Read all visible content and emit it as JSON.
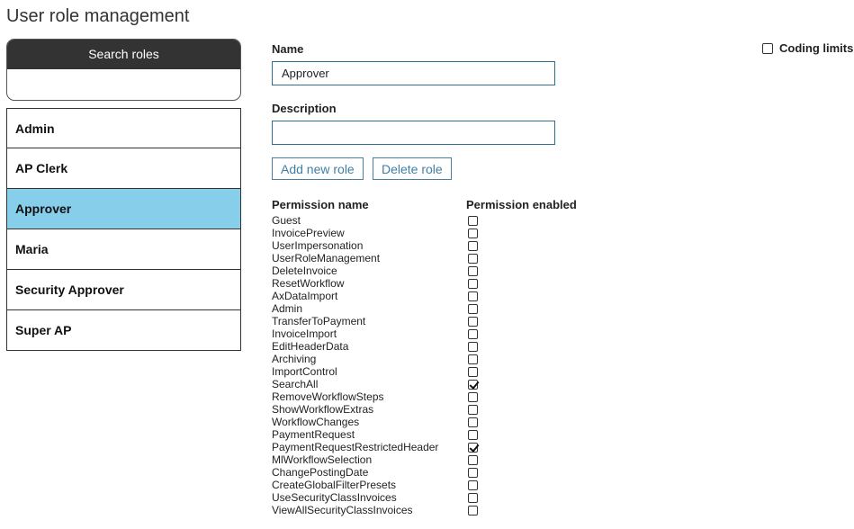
{
  "page": {
    "title": "User role management"
  },
  "search": {
    "header": "Search roles",
    "value": "",
    "placeholder": ""
  },
  "roles": [
    {
      "label": "Admin",
      "selected": false
    },
    {
      "label": "AP Clerk",
      "selected": false
    },
    {
      "label": "Approver",
      "selected": true
    },
    {
      "label": "Maria",
      "selected": false
    },
    {
      "label": "Security Approver",
      "selected": false
    },
    {
      "label": "Super AP",
      "selected": false
    }
  ],
  "form": {
    "name_label": "Name",
    "name_value": "Approver",
    "description_label": "Description",
    "description_value": "",
    "add_button": "Add new role",
    "delete_button": "Delete role",
    "coding_limits_label": "Coding limits",
    "coding_limits_checked": false
  },
  "permissions": {
    "name_header": "Permission name",
    "enabled_header": "Permission enabled",
    "items": [
      {
        "name": "Guest",
        "enabled": false
      },
      {
        "name": "InvoicePreview",
        "enabled": false
      },
      {
        "name": "UserImpersonation",
        "enabled": false
      },
      {
        "name": "UserRoleManagement",
        "enabled": false
      },
      {
        "name": "DeleteInvoice",
        "enabled": false
      },
      {
        "name": "ResetWorkflow",
        "enabled": false
      },
      {
        "name": "AxDataImport",
        "enabled": false
      },
      {
        "name": "Admin",
        "enabled": false
      },
      {
        "name": "TransferToPayment",
        "enabled": false
      },
      {
        "name": "InvoiceImport",
        "enabled": false
      },
      {
        "name": "EditHeaderData",
        "enabled": false
      },
      {
        "name": "Archiving",
        "enabled": false
      },
      {
        "name": "ImportControl",
        "enabled": false
      },
      {
        "name": "SearchAll",
        "enabled": true
      },
      {
        "name": "RemoveWorkflowSteps",
        "enabled": false
      },
      {
        "name": "ShowWorkflowExtras",
        "enabled": false
      },
      {
        "name": "WorkflowChanges",
        "enabled": false
      },
      {
        "name": "PaymentRequest",
        "enabled": false
      },
      {
        "name": "PaymentRequestRestrictedHeader",
        "enabled": true
      },
      {
        "name": "MlWorkflowSelection",
        "enabled": false
      },
      {
        "name": "ChangePostingDate",
        "enabled": false
      },
      {
        "name": "CreateGlobalFilterPresets",
        "enabled": false
      },
      {
        "name": "UseSecurityClassInvoices",
        "enabled": false
      },
      {
        "name": "ViewAllSecurityClassInvoices",
        "enabled": false
      }
    ]
  },
  "colors": {
    "selected_role_bg": "#87ceeb",
    "search_header_bg": "#333333",
    "field_border": "#2f6f8f",
    "button_text": "#3f7fa6"
  }
}
